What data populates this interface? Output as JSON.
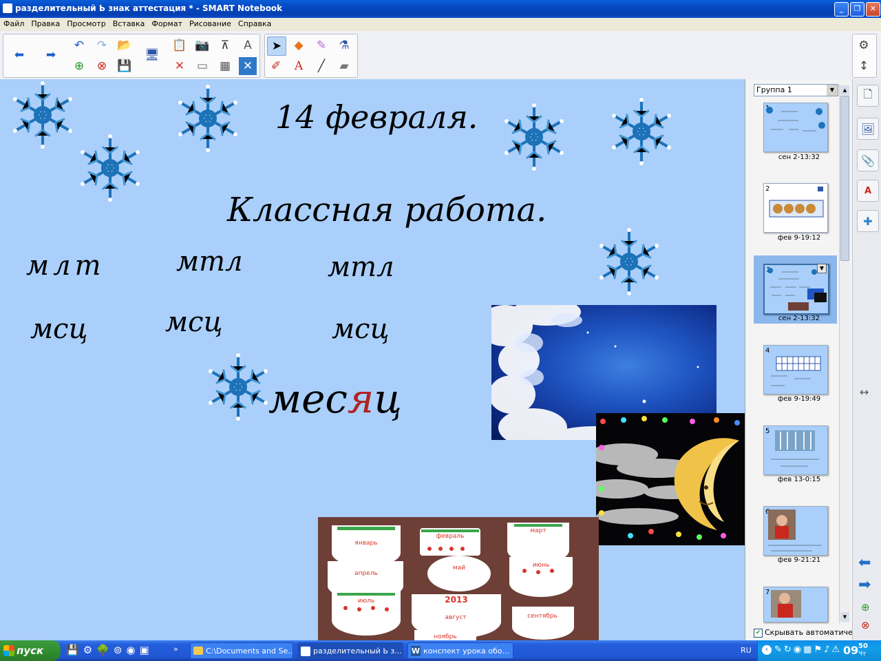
{
  "window": {
    "title": "разделительный Ь знак аттестация * - SMART Notebook",
    "minimize": "_",
    "maximize": "❐",
    "close": "✕"
  },
  "menu": [
    "Файл",
    "Правка",
    "Просмотр",
    "Вставка",
    "Формат",
    "Рисование",
    "Справка"
  ],
  "slide": {
    "date": "14 февраля.",
    "heading": "Классная работа.",
    "letters_row1": [
      "млт",
      "мтл",
      "мтл"
    ],
    "letters_row2": [
      "мсц",
      "мсц",
      "мсц"
    ],
    "word_start": "мес",
    "word_highlight": "я",
    "word_end": "ц",
    "highlight_color": "#b22222",
    "background_color": "#a9cffa",
    "calendar_year": "2013",
    "calendar_months": [
      "январь",
      "февраль",
      "март",
      "апрель",
      "май",
      "июнь",
      "июль",
      "август",
      "сентябрь",
      "ноябрь"
    ]
  },
  "page_sorter": {
    "group": "Группа 1",
    "pages": [
      {
        "num": "1",
        "label": "сен 2-13:32"
      },
      {
        "num": "2",
        "label": "фев 9-19:12"
      },
      {
        "num": "3",
        "label": "сен 2-13:32"
      },
      {
        "num": "4",
        "label": "фев 9-19:49"
      },
      {
        "num": "5",
        "label": "фев 13-0:15"
      },
      {
        "num": "6",
        "label": "фев 9-21:21"
      },
      {
        "num": "7",
        "label": ""
      }
    ],
    "selected_page": "3",
    "auto_hide": "Скрывать автоматическ"
  },
  "taskbar": {
    "start": "пуск",
    "tasks": [
      "C:\\Documents and Se...",
      "разделительный Ь з...",
      "конспект урока обо..."
    ],
    "language": "RU",
    "clock_hour": "09",
    "clock_minute": "50",
    "clock_day": "Чт"
  }
}
